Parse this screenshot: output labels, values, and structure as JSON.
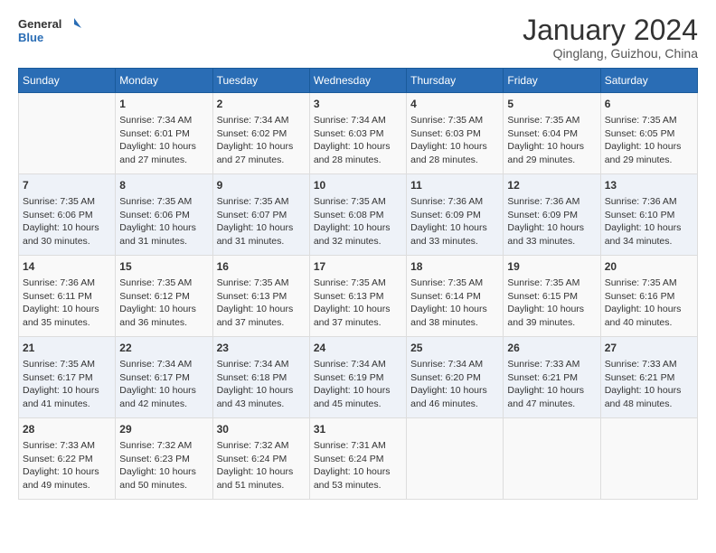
{
  "header": {
    "logo_line1": "General",
    "logo_line2": "Blue",
    "month": "January 2024",
    "location": "Qinglang, Guizhou, China"
  },
  "days_of_week": [
    "Sunday",
    "Monday",
    "Tuesday",
    "Wednesday",
    "Thursday",
    "Friday",
    "Saturday"
  ],
  "weeks": [
    [
      {
        "num": "",
        "lines": []
      },
      {
        "num": "1",
        "lines": [
          "Sunrise: 7:34 AM",
          "Sunset: 6:01 PM",
          "Daylight: 10 hours",
          "and 27 minutes."
        ]
      },
      {
        "num": "2",
        "lines": [
          "Sunrise: 7:34 AM",
          "Sunset: 6:02 PM",
          "Daylight: 10 hours",
          "and 27 minutes."
        ]
      },
      {
        "num": "3",
        "lines": [
          "Sunrise: 7:34 AM",
          "Sunset: 6:03 PM",
          "Daylight: 10 hours",
          "and 28 minutes."
        ]
      },
      {
        "num": "4",
        "lines": [
          "Sunrise: 7:35 AM",
          "Sunset: 6:03 PM",
          "Daylight: 10 hours",
          "and 28 minutes."
        ]
      },
      {
        "num": "5",
        "lines": [
          "Sunrise: 7:35 AM",
          "Sunset: 6:04 PM",
          "Daylight: 10 hours",
          "and 29 minutes."
        ]
      },
      {
        "num": "6",
        "lines": [
          "Sunrise: 7:35 AM",
          "Sunset: 6:05 PM",
          "Daylight: 10 hours",
          "and 29 minutes."
        ]
      }
    ],
    [
      {
        "num": "7",
        "lines": [
          "Sunrise: 7:35 AM",
          "Sunset: 6:06 PM",
          "Daylight: 10 hours",
          "and 30 minutes."
        ]
      },
      {
        "num": "8",
        "lines": [
          "Sunrise: 7:35 AM",
          "Sunset: 6:06 PM",
          "Daylight: 10 hours",
          "and 31 minutes."
        ]
      },
      {
        "num": "9",
        "lines": [
          "Sunrise: 7:35 AM",
          "Sunset: 6:07 PM",
          "Daylight: 10 hours",
          "and 31 minutes."
        ]
      },
      {
        "num": "10",
        "lines": [
          "Sunrise: 7:35 AM",
          "Sunset: 6:08 PM",
          "Daylight: 10 hours",
          "and 32 minutes."
        ]
      },
      {
        "num": "11",
        "lines": [
          "Sunrise: 7:36 AM",
          "Sunset: 6:09 PM",
          "Daylight: 10 hours",
          "and 33 minutes."
        ]
      },
      {
        "num": "12",
        "lines": [
          "Sunrise: 7:36 AM",
          "Sunset: 6:09 PM",
          "Daylight: 10 hours",
          "and 33 minutes."
        ]
      },
      {
        "num": "13",
        "lines": [
          "Sunrise: 7:36 AM",
          "Sunset: 6:10 PM",
          "Daylight: 10 hours",
          "and 34 minutes."
        ]
      }
    ],
    [
      {
        "num": "14",
        "lines": [
          "Sunrise: 7:36 AM",
          "Sunset: 6:11 PM",
          "Daylight: 10 hours",
          "and 35 minutes."
        ]
      },
      {
        "num": "15",
        "lines": [
          "Sunrise: 7:35 AM",
          "Sunset: 6:12 PM",
          "Daylight: 10 hours",
          "and 36 minutes."
        ]
      },
      {
        "num": "16",
        "lines": [
          "Sunrise: 7:35 AM",
          "Sunset: 6:13 PM",
          "Daylight: 10 hours",
          "and 37 minutes."
        ]
      },
      {
        "num": "17",
        "lines": [
          "Sunrise: 7:35 AM",
          "Sunset: 6:13 PM",
          "Daylight: 10 hours",
          "and 37 minutes."
        ]
      },
      {
        "num": "18",
        "lines": [
          "Sunrise: 7:35 AM",
          "Sunset: 6:14 PM",
          "Daylight: 10 hours",
          "and 38 minutes."
        ]
      },
      {
        "num": "19",
        "lines": [
          "Sunrise: 7:35 AM",
          "Sunset: 6:15 PM",
          "Daylight: 10 hours",
          "and 39 minutes."
        ]
      },
      {
        "num": "20",
        "lines": [
          "Sunrise: 7:35 AM",
          "Sunset: 6:16 PM",
          "Daylight: 10 hours",
          "and 40 minutes."
        ]
      }
    ],
    [
      {
        "num": "21",
        "lines": [
          "Sunrise: 7:35 AM",
          "Sunset: 6:17 PM",
          "Daylight: 10 hours",
          "and 41 minutes."
        ]
      },
      {
        "num": "22",
        "lines": [
          "Sunrise: 7:34 AM",
          "Sunset: 6:17 PM",
          "Daylight: 10 hours",
          "and 42 minutes."
        ]
      },
      {
        "num": "23",
        "lines": [
          "Sunrise: 7:34 AM",
          "Sunset: 6:18 PM",
          "Daylight: 10 hours",
          "and 43 minutes."
        ]
      },
      {
        "num": "24",
        "lines": [
          "Sunrise: 7:34 AM",
          "Sunset: 6:19 PM",
          "Daylight: 10 hours",
          "and 45 minutes."
        ]
      },
      {
        "num": "25",
        "lines": [
          "Sunrise: 7:34 AM",
          "Sunset: 6:20 PM",
          "Daylight: 10 hours",
          "and 46 minutes."
        ]
      },
      {
        "num": "26",
        "lines": [
          "Sunrise: 7:33 AM",
          "Sunset: 6:21 PM",
          "Daylight: 10 hours",
          "and 47 minutes."
        ]
      },
      {
        "num": "27",
        "lines": [
          "Sunrise: 7:33 AM",
          "Sunset: 6:21 PM",
          "Daylight: 10 hours",
          "and 48 minutes."
        ]
      }
    ],
    [
      {
        "num": "28",
        "lines": [
          "Sunrise: 7:33 AM",
          "Sunset: 6:22 PM",
          "Daylight: 10 hours",
          "and 49 minutes."
        ]
      },
      {
        "num": "29",
        "lines": [
          "Sunrise: 7:32 AM",
          "Sunset: 6:23 PM",
          "Daylight: 10 hours",
          "and 50 minutes."
        ]
      },
      {
        "num": "30",
        "lines": [
          "Sunrise: 7:32 AM",
          "Sunset: 6:24 PM",
          "Daylight: 10 hours",
          "and 51 minutes."
        ]
      },
      {
        "num": "31",
        "lines": [
          "Sunrise: 7:31 AM",
          "Sunset: 6:24 PM",
          "Daylight: 10 hours",
          "and 53 minutes."
        ]
      },
      {
        "num": "",
        "lines": []
      },
      {
        "num": "",
        "lines": []
      },
      {
        "num": "",
        "lines": []
      }
    ]
  ]
}
